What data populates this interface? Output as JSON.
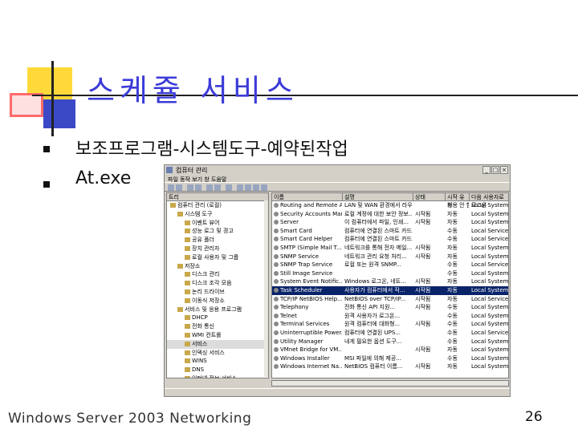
{
  "slide": {
    "title": "스케쥴 서비스",
    "bullets": [
      "보조프로그램-시스템도구-예약된작업",
      "At.exe"
    ],
    "footer": "Windows Server 2003 Networking",
    "page_number": "26"
  },
  "window": {
    "title": "컴퓨터 관리",
    "menu": "파일  동작  보기  창  도움말",
    "tree_header": "트리",
    "tree_items": [
      "컴퓨터 관리 (로컬)",
      "시스템 도구",
      "이벤트 뷰어",
      "성능 로그 및 경고",
      "공유 폴더",
      "장치 관리자",
      "로컬 사용자 및 그룹",
      "저장소",
      "디스크 관리",
      "디스크 조각 모음",
      "논리 드라이브",
      "이동식 저장소",
      "서비스 및 응용 프로그램",
      "DHCP",
      "전화 통신",
      "WMI 컨트롤",
      "서비스",
      "인덱싱 서비스",
      "WINS",
      "DNS",
      "인터넷 정보 서비스"
    ],
    "columns": [
      "이름",
      "설명",
      "상태",
      "시작 유형",
      "다음 사용자로 로그온"
    ],
    "rows": [
      [
        "Routing and Remote Access",
        "LAN 및 WAN 환경에서 라우팅...",
        "",
        "사용 안 함",
        "Local System"
      ],
      [
        "Security Accounts Manager",
        "로컬 계정에 대한 보안 정보...",
        "시작됨",
        "자동",
        "Local System"
      ],
      [
        "Server",
        "이 컴퓨터에서 파일, 인쇄...",
        "시작됨",
        "자동",
        "Local System"
      ],
      [
        "Smart Card",
        "컴퓨터에 연결된 스마트 카드...",
        "",
        "수동",
        "Local Service"
      ],
      [
        "Smart Card Helper",
        "컴퓨터에 연결된 스마트 카드...",
        "",
        "수동",
        "Local Service"
      ],
      [
        "SMTP (Simple Mail T...",
        "네트워크를 통해 전자 메일...",
        "시작됨",
        "자동",
        "Local System"
      ],
      [
        "SNMP Service",
        "네트워크 관리 요청 처리...",
        "시작됨",
        "자동",
        "Local System"
      ],
      [
        "SNMP Trap Service",
        "로컬 또는 원격 SNMP...",
        "",
        "수동",
        "Local Service"
      ],
      [
        "Still Image Service",
        "",
        "",
        "수동",
        "Local System"
      ],
      [
        "System Event Notific...",
        "Windows 로그온, 네트...",
        "시작됨",
        "자동",
        "Local System"
      ],
      [
        "Task Scheduler",
        "사용자가 컴퓨터에서 작...",
        "시작됨",
        "자동",
        "Local System"
      ],
      [
        "TCP/IP NetBIOS Help...",
        "NetBIOS over TCP/IP...",
        "시작됨",
        "자동",
        "Local Service"
      ],
      [
        "Telephony",
        "전화 통신 API 지원...",
        "시작됨",
        "수동",
        "Local System"
      ],
      [
        "Telnet",
        "원격 사용자가 로그온...",
        "",
        "수동",
        "Local System"
      ],
      [
        "Terminal Services",
        "원격 컴퓨터에 대화형...",
        "시작됨",
        "수동",
        "Local System"
      ],
      [
        "Uninterruptible Power...",
        "컴퓨터에 연결된 UPS...",
        "",
        "수동",
        "Local Service"
      ],
      [
        "Utility Manager",
        "내게 필요한 옵션 도구...",
        "",
        "수동",
        "Local System"
      ],
      [
        "VMnet Bridge for VM...",
        "",
        "시작됨",
        "자동",
        "Local System"
      ],
      [
        "Windows Installer",
        "MSI 파일에 의해 제공...",
        "",
        "수동",
        "Local System"
      ],
      [
        "Windows Internet Na...",
        "NetBIOS 컴퓨터 이름...",
        "시작됨",
        "자동",
        "Local System"
      ]
    ],
    "selected_row": 10,
    "selected_tree_item": 16
  },
  "colors": {
    "title": "#3b3bd8",
    "selection": "#0a246a",
    "window_chrome": "#d4d0c8"
  }
}
